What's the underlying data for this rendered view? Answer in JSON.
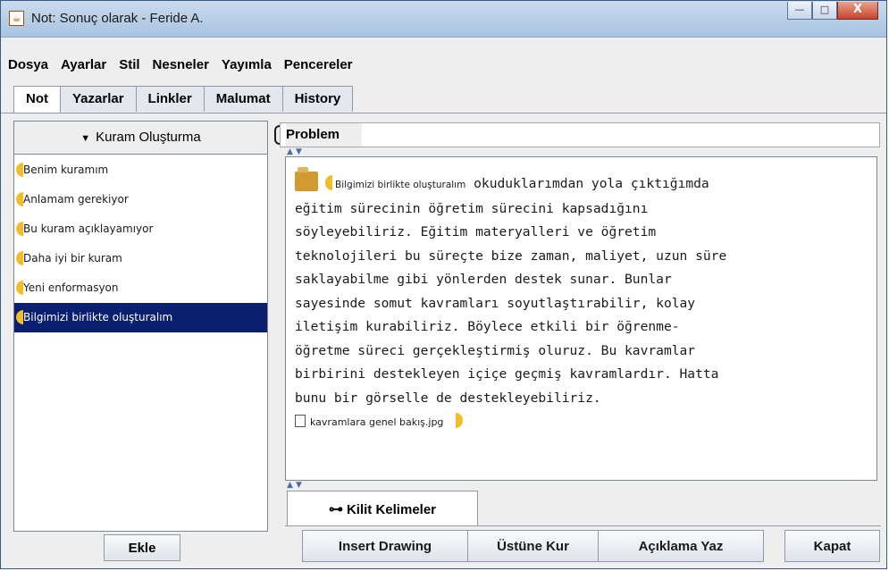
{
  "window": {
    "title": "Not: Sonuç olarak - Feride A.",
    "app_icon": "java-cup-icon",
    "controls": {
      "minimize": "—",
      "maximize": "□",
      "close": "X"
    }
  },
  "menu": [
    "Dosya",
    "Ayarlar",
    "Stil",
    "Nesneler",
    "Yayımla",
    "Pencereler"
  ],
  "tabs": [
    "Not",
    "Yazarlar",
    "Linkler",
    "Malumat",
    "History"
  ],
  "sidebar": {
    "header": "Kuram Oluşturma",
    "header_icon": "triangle-down-icon",
    "items": [
      "Benim kuramım",
      "Anlamam gerekiyor",
      "Bu kuram açıklayamıyor",
      "Daha iyi bir kuram",
      "Yeni enformasyon",
      "Bilgimizi birlikte oluşturalım"
    ],
    "selected_item": "Bilgimizi birlikte oluşturalım",
    "add_button": "Ekle"
  },
  "problem": {
    "label": "Problem",
    "value": ""
  },
  "note": {
    "scaffold_tag": "Bilgimizi birlikte oluşturalım",
    "lines": [
      "okuduklarımdan yola çıktığımda",
      "eğitim sürecinin öğretim sürecini kapsadığını",
      "söyleyebiliriz. Eğitim materyalleri ve öğretim",
      "teknolojileri bu süreçte bize zaman, maliyet, uzun süre",
      "saklayabilme gibi yönlerden destek sunar. Bunlar",
      "sayesinde somut kavramları soyutlaştırabilir, kolay",
      "iletişim kurabiliriz. Böylece etkili bir öğrenme-",
      "öğretme süreci gerçekleştirmiş oluruz. Bu kavramlar",
      "birbirini destekleyen içiçe geçmiş kavramlardır. Hatta",
      "bunu bir görselle de destekleyebiliriz."
    ],
    "attachment": "kavramlara genel bakış.jpg"
  },
  "keywords_tab": {
    "label": "Kilit Kelimeler",
    "icon": "key-icon"
  },
  "buttons": {
    "insert_drawing": "Insert Drawing",
    "ustune_kur": "Üstüne Kur",
    "aciklama_yaz": "Açıklama Yaz",
    "kapat": "Kapat"
  }
}
